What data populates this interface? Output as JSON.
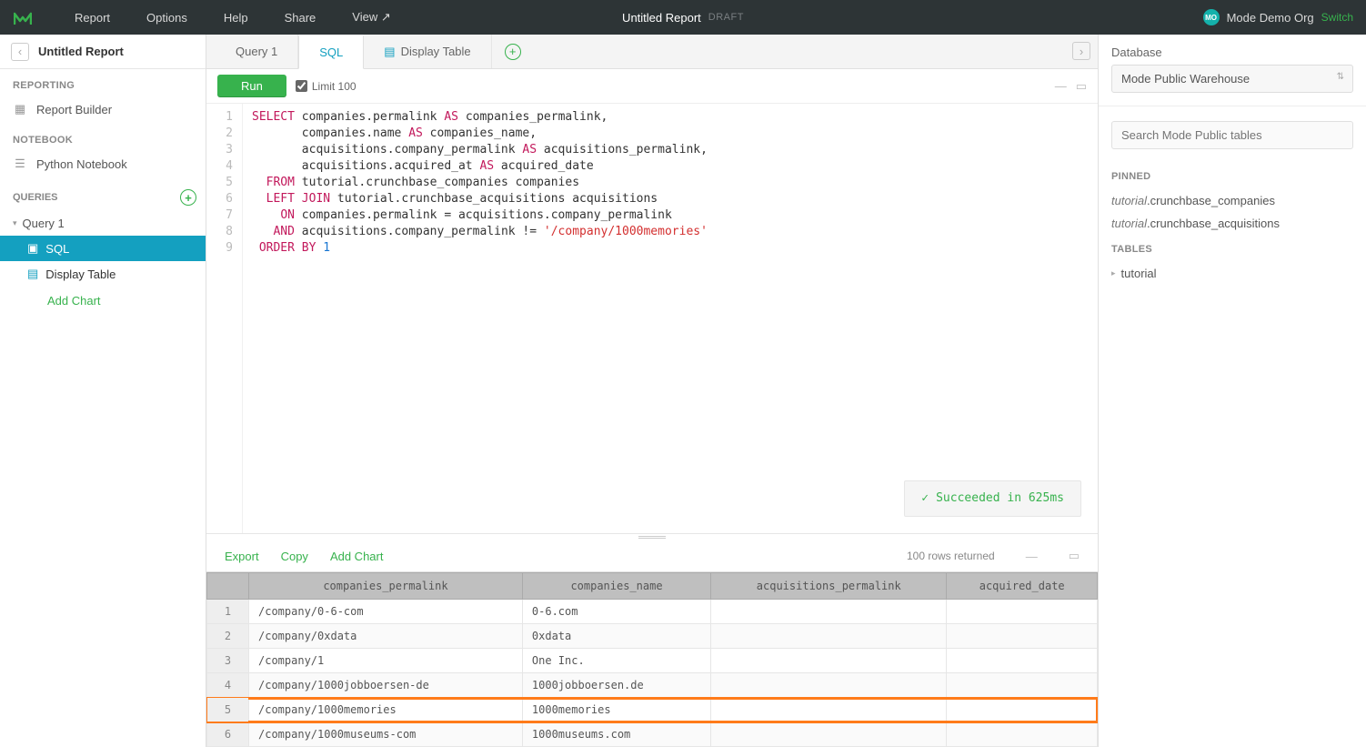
{
  "topbar": {
    "menu": [
      "Report",
      "Options",
      "Help",
      "Share",
      "View ↗"
    ],
    "title": "Untitled Report",
    "badge": "DRAFT",
    "orgInitials": "MO",
    "orgName": "Mode Demo Org",
    "switch": "Switch"
  },
  "sidebar": {
    "back": "‹",
    "title": "Untitled Report",
    "reporting_label": "REPORTING",
    "report_builder": "Report Builder",
    "notebook_label": "NOTEBOOK",
    "python_nb": "Python Notebook",
    "queries_label": "QUERIES",
    "query1": "Query 1",
    "sql": "SQL",
    "display_table": "Display Table",
    "add_chart": "Add Chart"
  },
  "tabs": {
    "query1": "Query 1",
    "sql": "SQL",
    "display_table": "Display Table"
  },
  "toolbar": {
    "run": "Run",
    "limit": "Limit 100"
  },
  "code_lines": [
    "SELECT companies.permalink AS companies_permalink,",
    "       companies.name AS companies_name,",
    "       acquisitions.company_permalink AS acquisitions_permalink,",
    "       acquisitions.acquired_at AS acquired_date",
    "  FROM tutorial.crunchbase_companies companies",
    "  LEFT JOIN tutorial.crunchbase_acquisitions acquisitions",
    "    ON companies.permalink = acquisitions.company_permalink",
    "   AND acquisitions.company_permalink != '/company/1000memories'",
    " ORDER BY 1"
  ],
  "status": "Succeeded in 625ms",
  "results_bar": {
    "export": "Export",
    "copy": "Copy",
    "add_chart": "Add Chart",
    "rows": "100 rows returned"
  },
  "table": {
    "columns": [
      "companies_permalink",
      "companies_name",
      "acquisitions_permalink",
      "acquired_date"
    ],
    "rows": [
      {
        "n": 1,
        "cells": [
          "/company/0-6-com",
          "0-6.com",
          "",
          ""
        ]
      },
      {
        "n": 2,
        "cells": [
          "/company/0xdata",
          "0xdata",
          "",
          ""
        ]
      },
      {
        "n": 3,
        "cells": [
          "/company/1",
          "One Inc.",
          "",
          ""
        ]
      },
      {
        "n": 4,
        "cells": [
          "/company/1000jobboersen-de",
          "1000jobboersen.de",
          "",
          ""
        ]
      },
      {
        "n": 5,
        "cells": [
          "/company/1000memories",
          "1000memories",
          "",
          ""
        ],
        "highlight": true
      },
      {
        "n": 6,
        "cells": [
          "/company/1000museums-com",
          "1000museums.com",
          "",
          ""
        ]
      }
    ]
  },
  "rightpanel": {
    "db_label": "Database",
    "db_value": "Mode Public Warehouse",
    "search_placeholder": "Search Mode Public tables",
    "pinned_label": "PINNED",
    "pinned": [
      {
        "schema": "tutorial",
        "table": ".crunchbase_companies"
      },
      {
        "schema": "tutorial",
        "table": ".crunchbase_acquisitions"
      }
    ],
    "tables_label": "TABLES",
    "tree_item": "tutorial"
  }
}
